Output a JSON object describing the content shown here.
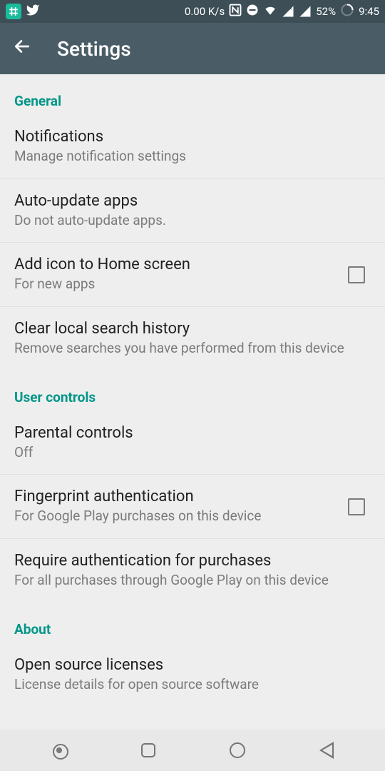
{
  "status": {
    "netspeed": "0.00 K/s",
    "battery_pct": "52%",
    "time": "9:45"
  },
  "header": {
    "title": "Settings"
  },
  "sections": {
    "general": {
      "label": "General",
      "notifications": {
        "title": "Notifications",
        "sub": "Manage notification settings"
      },
      "autoupdate": {
        "title": "Auto-update apps",
        "sub": "Do not auto-update apps."
      },
      "addicon": {
        "title": "Add icon to Home screen",
        "sub": "For new apps"
      },
      "clearhistory": {
        "title": "Clear local search history",
        "sub": "Remove searches you have performed from this device"
      }
    },
    "user_controls": {
      "label": "User controls",
      "parental": {
        "title": "Parental controls",
        "sub": "Off"
      },
      "fingerprint": {
        "title": "Fingerprint authentication",
        "sub": "For Google Play purchases on this device"
      },
      "requireauth": {
        "title": "Require authentication for purchases",
        "sub": "For all purchases through Google Play on this device"
      }
    },
    "about": {
      "label": "About",
      "opensource": {
        "title": "Open source licenses",
        "sub": "License details for open source software"
      }
    }
  }
}
